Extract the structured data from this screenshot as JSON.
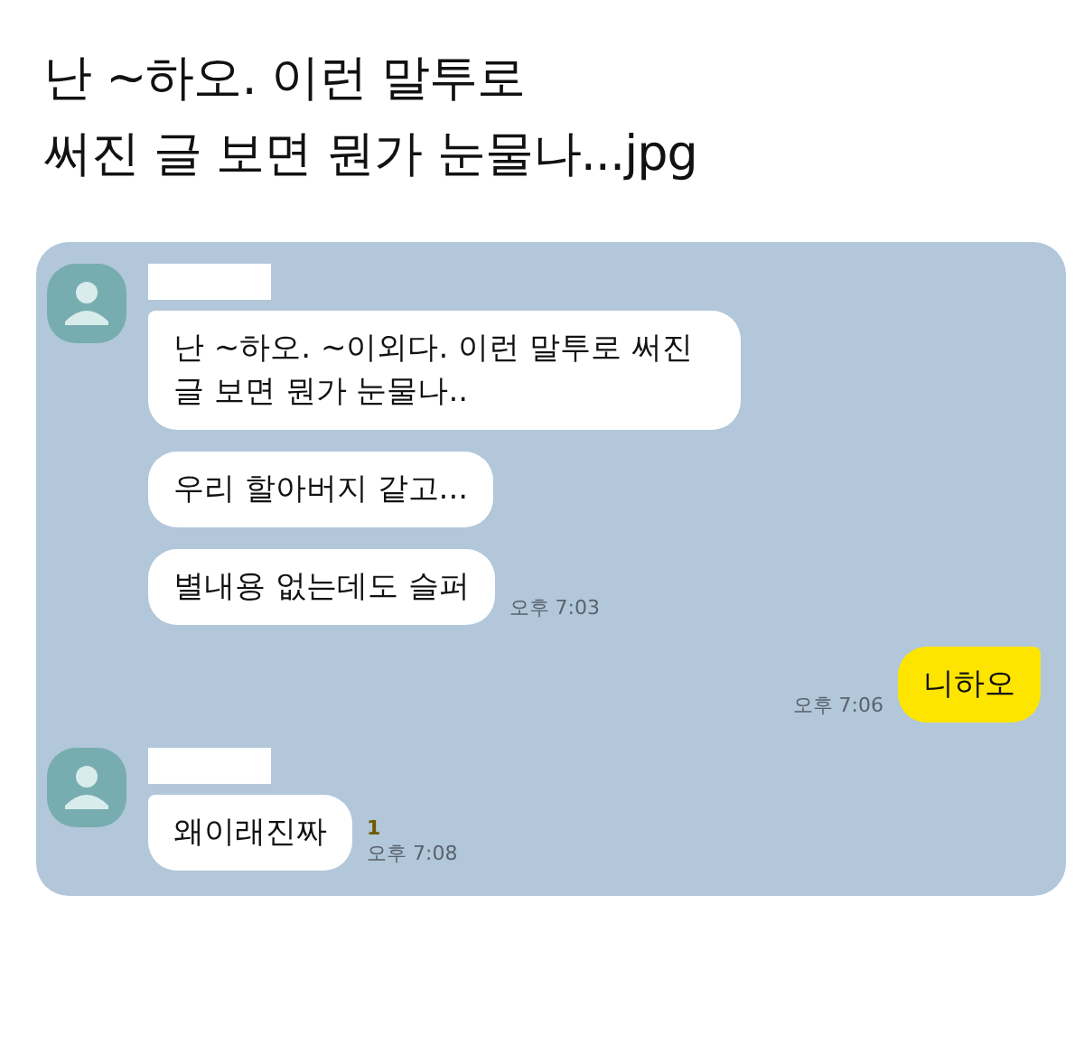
{
  "post_title": [
    "난 ~하오. 이런 말투로",
    "써진 글 보면 뭔가 눈물나...jpg"
  ],
  "chat": {
    "messages": [
      {
        "kind": "incoming",
        "bubbles": [
          "난 ~하오. ~이외다. 이런 말투로 써진 글 보면 뭔가 눈물나..",
          "우리 할아버지 같고...",
          "별내용 없는데도 슬퍼"
        ],
        "time": "오후 7:03"
      },
      {
        "kind": "outgoing",
        "bubbles": [
          "니하오"
        ],
        "time": "오후 7:06"
      },
      {
        "kind": "incoming",
        "bubbles": [
          "왜이래진짜"
        ],
        "unread": "1",
        "time": "오후 7:08"
      }
    ]
  }
}
